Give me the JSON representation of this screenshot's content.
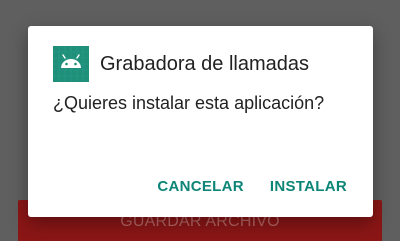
{
  "background": {
    "button_label": "GUARDAR ARCHIVO"
  },
  "dialog": {
    "app_icon": "android-icon",
    "app_name": "Grabadora de llamadas",
    "message": "¿Quieres instalar esta aplicación?",
    "cancel_label": "CANCELAR",
    "install_label": "INSTALAR"
  },
  "colors": {
    "accent": "#0d8577",
    "icon_bg": "#1f8f7a",
    "background_button": "#8b1616",
    "scrim": "#5f5f5f"
  }
}
